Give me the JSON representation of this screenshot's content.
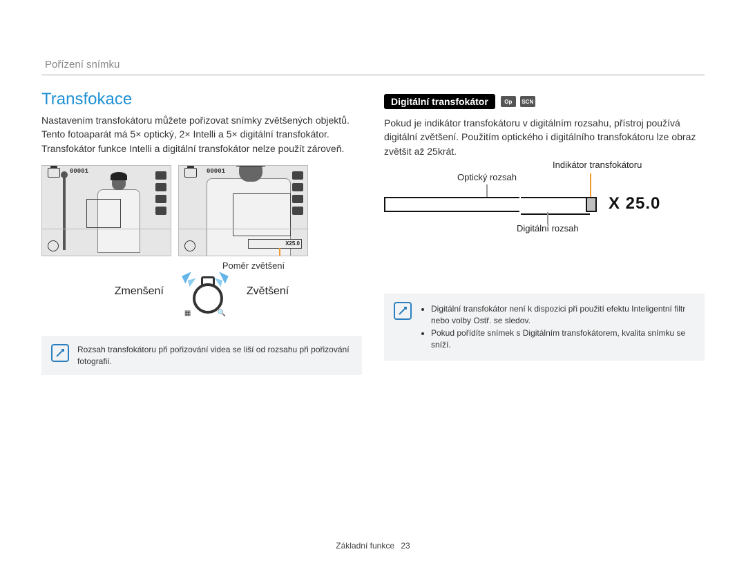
{
  "header": {
    "breadcrumb": "Pořízení snímku"
  },
  "left": {
    "title": "Transfokace",
    "body": "Nastavením transfokátoru můžete pořizovat snímky zvětšených objektů. Tento fotoaparát má 5× optický, 2× Intelli a 5× digitální transfokátor. Transfokátor funkce Intelli a digitální transfokátor nelze použít zároveň.",
    "osd_counter": "00001",
    "zoom_readout_small": "X25.0",
    "callout_ratio": "Poměr zvětšení",
    "label_zoom_out": "Zmenšení",
    "label_zoom_in": "Zvětšení",
    "note": "Rozsah transfokátoru při pořizování videa se liší od rozsahu při pořizování fotografií."
  },
  "right": {
    "subheading": "Digitální transfokátor",
    "body": "Pokud je indikátor transfokátoru v digitálním rozsahu, přístroj používá digitální zvětšení. Použitím optického i digitálního transfokátoru lze obraz zvětšit až 25krát.",
    "label_indicator": "Indikátor transfokátoru",
    "label_optical": "Optický rozsah",
    "label_digital": "Digitální rozsah",
    "zoom_readout": "X 25.0",
    "note_items": [
      "Digitální transfokátor není k dispozici při použití efektu Inteligentní filtr nebo volby Ostř. se sledov.",
      "Pokud pořídíte snímek s Digitálním transfokátorem, kvalita snímku se sníží."
    ]
  },
  "footer": {
    "section": "Základní funkce",
    "page": "23"
  }
}
